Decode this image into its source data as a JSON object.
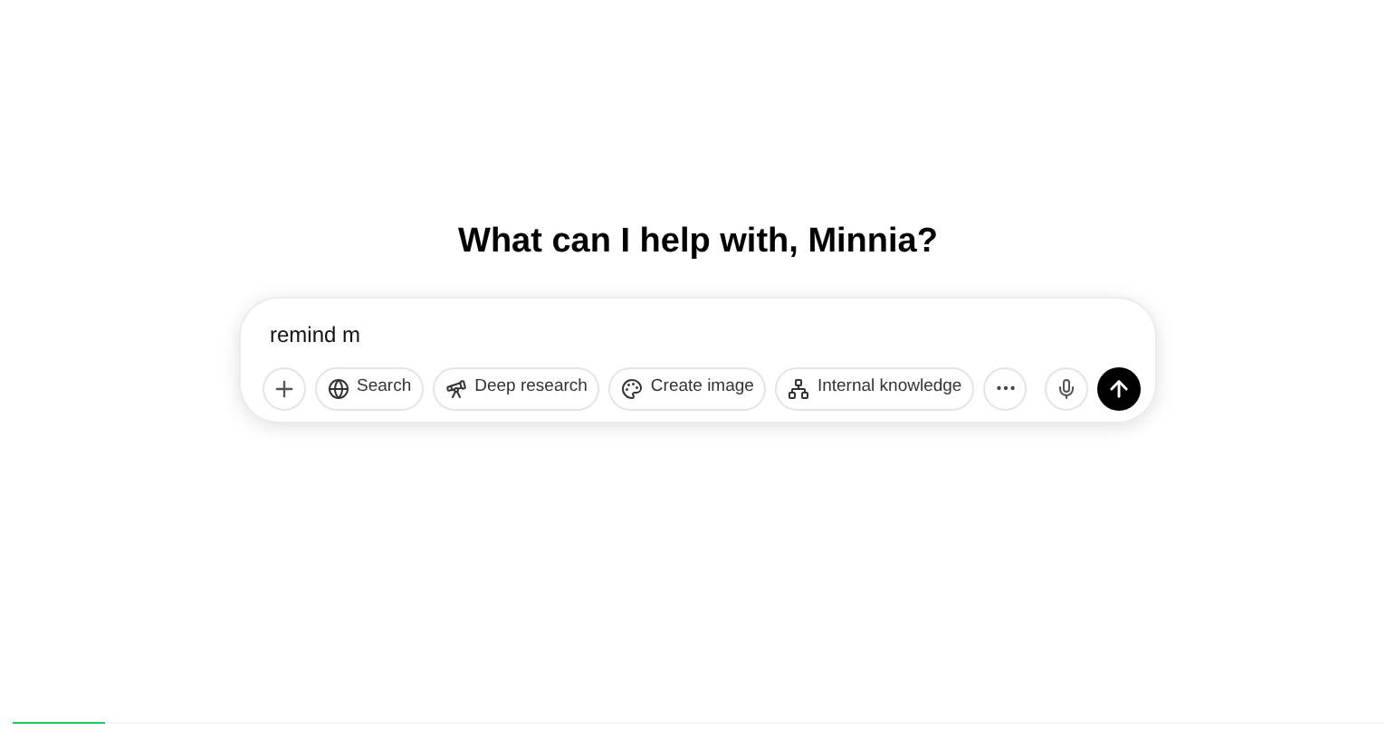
{
  "heading": "What can I help with, Minnia?",
  "composer": {
    "value": "remind m"
  },
  "tools": [
    {
      "kind": "search",
      "label": "Search"
    },
    {
      "kind": "research",
      "label": "Deep research"
    },
    {
      "kind": "image",
      "label": "Create image"
    },
    {
      "kind": "knowledge",
      "label": "Internal knowledge"
    }
  ],
  "progress": {
    "level": 0.067
  }
}
